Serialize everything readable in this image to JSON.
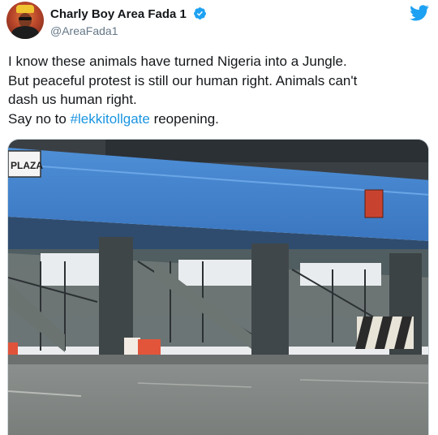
{
  "author": {
    "display_name": "Charly Boy Area Fada 1",
    "handle": "@AreaFada1",
    "verified": true,
    "avatar_icon": "profile-avatar-photo"
  },
  "platform_icon": "twitter-bird-icon",
  "tweet": {
    "lines": [
      "I know these animals have turned Nigeria into a Jungle.",
      "But peaceful protest is still our human right. Animals can't",
      "dash us human right."
    ],
    "last_line_prefix": "Say no to ",
    "hashtag": "#lekkitollgate",
    "last_line_suffix": " reopening."
  },
  "media": {
    "sign_text": "PLAZA",
    "description_icon": "toll-gate-photo"
  },
  "colors": {
    "accent": "#1b95e0",
    "text": "#14171a",
    "secondary": "#657786"
  }
}
